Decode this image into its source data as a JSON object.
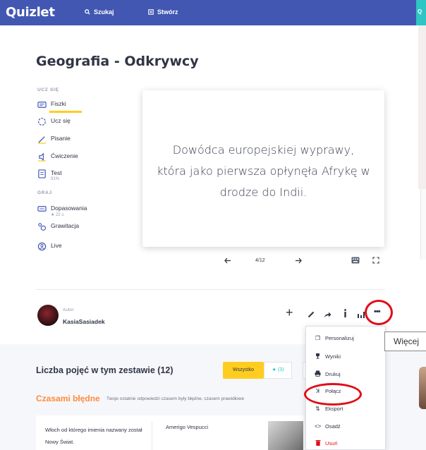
{
  "topbar": {
    "logo": "Quizlet",
    "search_label": "Szukaj",
    "create_label": "Stwórz",
    "cta_fragment": "Q"
  },
  "set": {
    "title": "Geografia - Odkrywcy"
  },
  "study": {
    "section_learn": "UCZ SIĘ",
    "modes": [
      {
        "label": "Fiszki",
        "icon": "flashcards-icon"
      },
      {
        "label": "Ucz się",
        "icon": "learn-icon"
      },
      {
        "label": "Pisanie",
        "icon": "write-icon"
      },
      {
        "label": "Ćwiczenie",
        "icon": "spell-icon"
      },
      {
        "label": "Test",
        "sub": "91%",
        "icon": "test-icon"
      }
    ],
    "section_play": "GRAJ",
    "games": [
      {
        "label": "Dopasowania",
        "sub": "★ 22 s",
        "icon": "match-icon"
      },
      {
        "label": "Grawitacja",
        "icon": "gravity-icon"
      },
      {
        "label": "Live",
        "icon": "live-icon"
      }
    ]
  },
  "card": {
    "text": "Dowódca europejskiej wyprawy, która jako pierwsza opłynęła Afrykę w drodze do Indii.",
    "progress": "4/12"
  },
  "author": {
    "label": "Autor",
    "name": "KasiaSasiadek"
  },
  "tooltip": "Więcej",
  "menu": [
    {
      "label": "Personalizuj",
      "icon": "copy-icon",
      "color": "#303545"
    },
    {
      "label": "Wyniki",
      "icon": "trophy-icon",
      "color": "#303545"
    },
    {
      "label": "Drukuj",
      "icon": "print-icon",
      "color": "#303545"
    },
    {
      "label": "Połącz",
      "icon": "combine-icon",
      "color": "#303545"
    },
    {
      "label": "Eksport",
      "icon": "export-icon",
      "color": "#303545"
    },
    {
      "label": "Osadź",
      "icon": "embed-icon",
      "color": "#303545"
    },
    {
      "label": "Usuń",
      "icon": "trash-icon",
      "color": "#e30b17"
    }
  ],
  "terms_section": {
    "heading": "Liczba pojęć w tym zestawie (12)",
    "filter_all": "Wszystko",
    "filter_starred": "★ (3)",
    "struggling_title": "Czasami błędne",
    "struggling_sub": "Twoje ostatnie odpowiedzi czasem były błędne, czasem prawidłowe",
    "first_term": "Włoch od którego imienia nazwany został Nowy Świat.",
    "first_definition": "Amerigo Vespucci"
  },
  "colors": {
    "brand": "#4257b2",
    "accent_yellow": "#ffcd1f",
    "highlight_ring": "#e30b17",
    "orange": "#ff8b3d"
  }
}
